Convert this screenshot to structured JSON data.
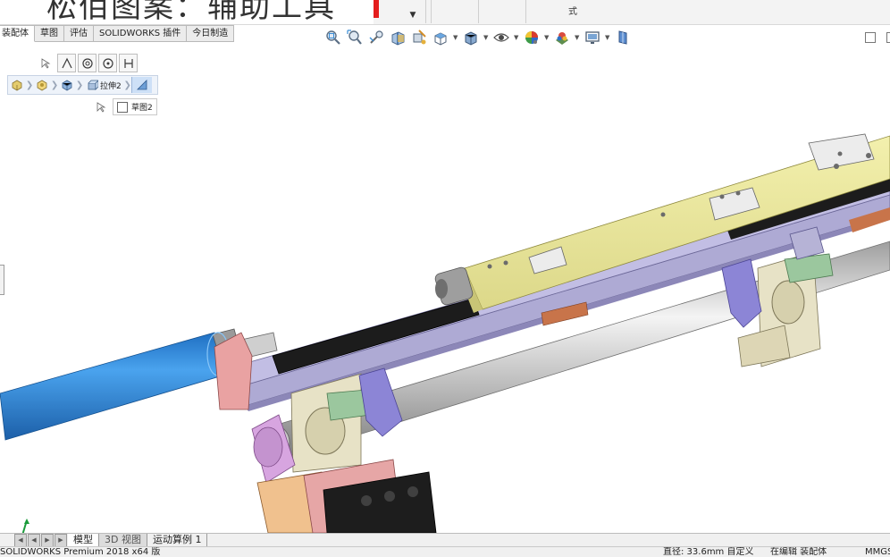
{
  "title_banner": "松佰图案：辅助工具",
  "ribbon": {
    "small_label": "式"
  },
  "command_tabs": [
    {
      "label": "装配体",
      "active": true
    },
    {
      "label": "草图",
      "active": false
    },
    {
      "label": "评估",
      "active": false
    },
    {
      "label": "SOLIDWORKS 插件",
      "active": false
    },
    {
      "label": "今日制造",
      "active": false
    }
  ],
  "breadcrumb": {
    "feature_label": "拉伸2"
  },
  "sketch": {
    "label": "草图2"
  },
  "bottom_tabs": [
    {
      "label": "模型",
      "active": true
    },
    {
      "label": "3D 视图",
      "active": false
    },
    {
      "label": "运动算例 1",
      "active": false
    }
  ],
  "status": {
    "app": "SOLIDWORKS Premium 2018 x64 版",
    "measure": "直径: 33.6mm  自定义",
    "mode": "在编辑 装配体",
    "units": "MMGS"
  },
  "icons": {
    "view_toolbar": [
      "zoom-to-fit-icon",
      "zoom-area-icon",
      "previous-view-icon",
      "section-view-icon",
      "dynamic-annotation-icon",
      "view-orientation-icon",
      "display-style-icon",
      "hide-show-icon",
      "edit-appearance-icon",
      "apply-scene-icon",
      "view-settings-icon",
      "display-pane-icon"
    ]
  },
  "colors": {
    "yellow_beam": "#ece99a",
    "purple_rail": "#b3afd6",
    "cylinder_blue": "#2f86d9",
    "pink_bracket": "#eba6a6",
    "bearing_tan": "#e7e2c6"
  }
}
